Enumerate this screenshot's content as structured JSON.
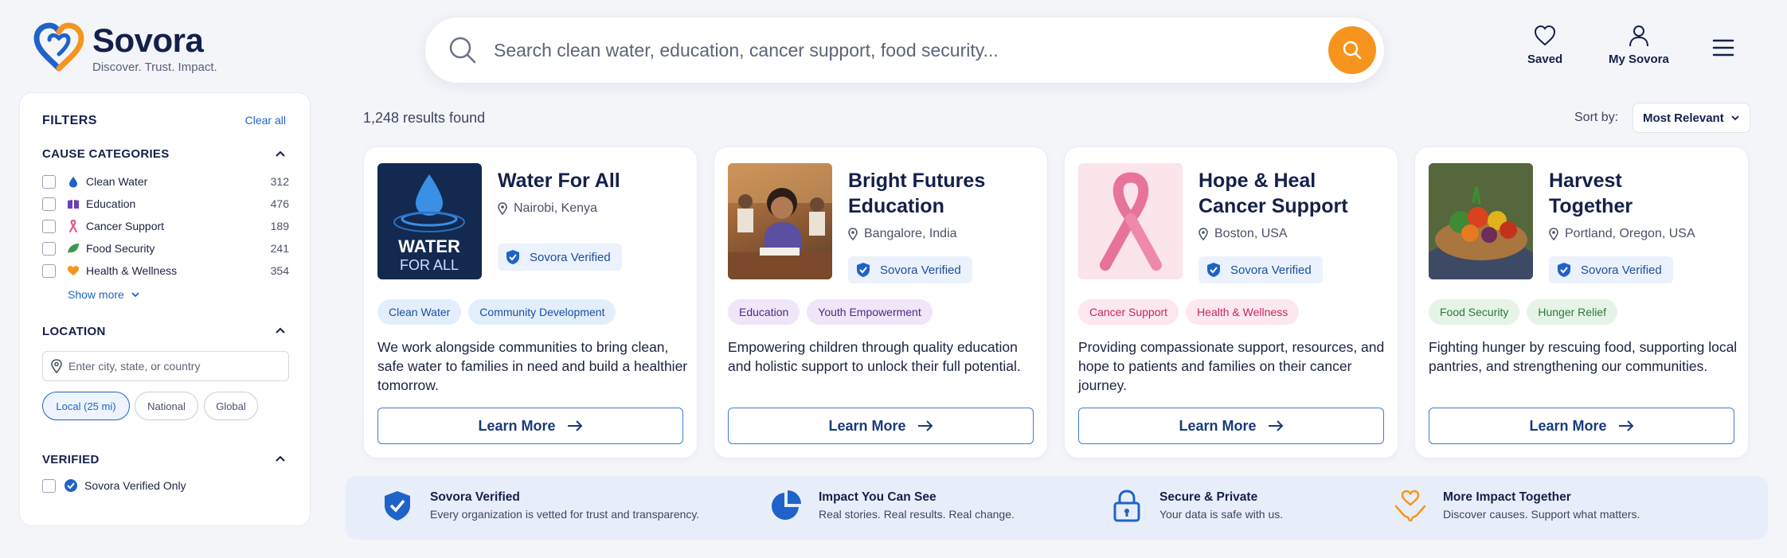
{
  "brand": {
    "name": "Sovora",
    "tagline": "Discover. Trust. Impact."
  },
  "search": {
    "placeholder": "Search clean water, education, cancer support, food security..."
  },
  "header_actions": {
    "saved": "Saved",
    "account": "My Sovora"
  },
  "filters": {
    "title": "FILTERS",
    "clear_all": "Clear all",
    "cause_title": "CAUSE CATEGORIES",
    "causes": [
      {
        "label": "Clean Water",
        "count": "312",
        "icon": "water-drop-icon",
        "color": "#1f63c9"
      },
      {
        "label": "Education",
        "count": "476",
        "icon": "book-icon",
        "color": "#6a3fb6"
      },
      {
        "label": "Cancer Support",
        "count": "189",
        "icon": "ribbon-icon",
        "color": "#e05a8c"
      },
      {
        "label": "Food Security",
        "count": "241",
        "icon": "leaf-icon",
        "color": "#3b9a4a"
      },
      {
        "label": "Health & Wellness",
        "count": "354",
        "icon": "heart-icon",
        "color": "#f7941d"
      }
    ],
    "show_more": "Show more",
    "location_title": "LOCATION",
    "location_placeholder": "Enter city, state, or country",
    "distance": [
      "Local (25 mi)",
      "National",
      "Global"
    ],
    "distance_selected": "Local (25 mi)",
    "verified_title": "VERIFIED",
    "verified_only": "Sovora Verified Only"
  },
  "results": {
    "count": "1,248 results found",
    "sort_label": "Sort by:",
    "sort_value": "Most Relevant"
  },
  "cards": [
    {
      "title_lines": [
        "Water For All"
      ],
      "location": "Nairobi, Kenya",
      "verified": "Sovora Verified",
      "logo_text": [
        "WATER",
        "FOR ALL"
      ],
      "tags": [
        {
          "label": "Clean Water",
          "bg": "#e3eefc",
          "fg": "#1b4fa0"
        },
        {
          "label": "Community Development",
          "bg": "#e3eefc",
          "fg": "#1b4fa0"
        }
      ],
      "description": "We work alongside communities to bring clean, safe water to families in need and build a healthier tomorrow.",
      "cta": "Learn More"
    },
    {
      "title_lines": [
        "Bright Futures",
        "Education"
      ],
      "location": "Bangalore, India",
      "verified": "Sovora Verified",
      "tags": [
        {
          "label": "Education",
          "bg": "#efe6f8",
          "fg": "#4b2a86"
        },
        {
          "label": "Youth Empowerment",
          "bg": "#efe6f8",
          "fg": "#4b2a86"
        }
      ],
      "description": "Empowering children through quality education and holistic support to unlock their full potential.",
      "cta": "Learn More"
    },
    {
      "title_lines": [
        "Hope & Heal",
        "Cancer Support"
      ],
      "location": "Boston, USA",
      "verified": "Sovora Verified",
      "tags": [
        {
          "label": "Cancer Support",
          "bg": "#fde8ef",
          "fg": "#c2275f"
        },
        {
          "label": "Health & Wellness",
          "bg": "#fde8ef",
          "fg": "#c2275f"
        }
      ],
      "description": "Providing compassionate support, resources, and hope to patients and families on their cancer journey.",
      "cta": "Learn More"
    },
    {
      "title_lines": [
        "Harvest",
        "Together"
      ],
      "location": "Portland, Oregon, USA",
      "verified": "Sovora Verified",
      "tags": [
        {
          "label": "Food Security",
          "bg": "#e5f4e6",
          "fg": "#2a7a36"
        },
        {
          "label": "Hunger Relief",
          "bg": "#e5f4e6",
          "fg": "#2a7a36"
        }
      ],
      "description": "Fighting hunger by rescuing food, supporting local pantries, and strengthening our communities.",
      "cta": "Learn More"
    }
  ],
  "trust": [
    {
      "title": "Sovora Verified",
      "sub": "Every organization is vetted for trust and transparency.",
      "icon": "shield-check-icon"
    },
    {
      "title": "Impact You Can See",
      "sub": "Real stories. Real results. Real change.",
      "icon": "pie-chart-icon"
    },
    {
      "title": "Secure & Private",
      "sub": "Your data is safe with us.",
      "icon": "lock-icon"
    },
    {
      "title": "More Impact Together",
      "sub": "Discover causes. Support what matters.",
      "icon": "hands-heart-icon"
    }
  ],
  "colors": {
    "primary": "#1f63c9",
    "accent": "#f7941d",
    "navy": "#14204a"
  }
}
